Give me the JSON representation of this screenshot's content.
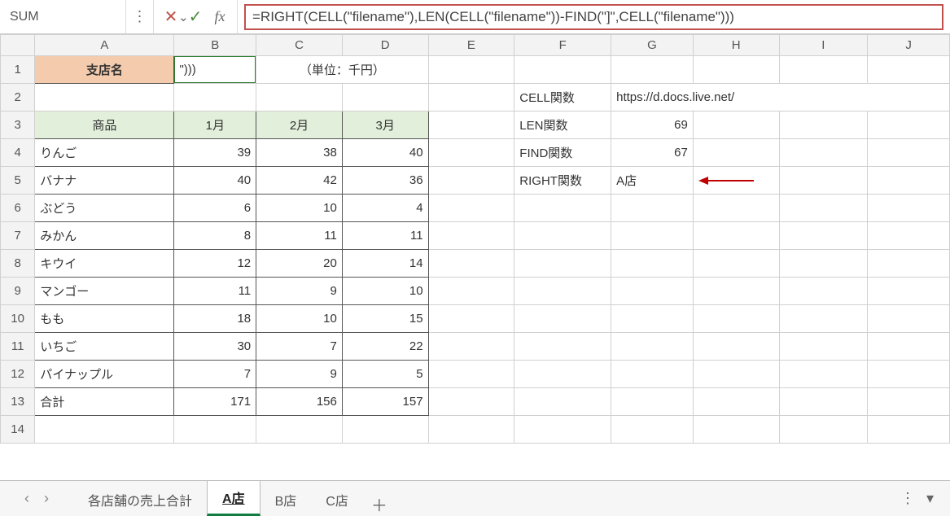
{
  "formula_bar": {
    "name_box": "SUM",
    "formula": "=RIGHT(CELL(\"filename\"),LEN(CELL(\"filename\"))-FIND(\"]\",CELL(\"filename\")))"
  },
  "columns": [
    "A",
    "B",
    "C",
    "D",
    "E",
    "F",
    "G",
    "H",
    "I",
    "J"
  ],
  "row_headers": [
    "1",
    "2",
    "3",
    "4",
    "5",
    "6",
    "7",
    "8",
    "9",
    "10",
    "11",
    "12",
    "13",
    "14"
  ],
  "cells": {
    "A1": "支店名",
    "B1": "\")))",
    "CD1": "（単位：千円）",
    "A3": "商品",
    "B3": "1月",
    "C3": "2月",
    "D3": "3月",
    "F2": "CELL関数",
    "G2": "https://d.docs.live.net/",
    "F3": "LEN関数",
    "G3": "69",
    "F4": "FIND関数",
    "G4": "67",
    "F5": "RIGHT関数",
    "G5": "A店"
  },
  "data_rows": [
    {
      "name": "りんご",
      "m1": "39",
      "m2": "38",
      "m3": "40"
    },
    {
      "name": "バナナ",
      "m1": "40",
      "m2": "42",
      "m3": "36"
    },
    {
      "name": "ぶどう",
      "m1": "6",
      "m2": "10",
      "m3": "4"
    },
    {
      "name": "みかん",
      "m1": "8",
      "m2": "11",
      "m3": "11"
    },
    {
      "name": "キウイ",
      "m1": "12",
      "m2": "20",
      "m3": "14"
    },
    {
      "name": "マンゴー",
      "m1": "11",
      "m2": "9",
      "m3": "10"
    },
    {
      "name": "もも",
      "m1": "18",
      "m2": "10",
      "m3": "15"
    },
    {
      "name": "いちご",
      "m1": "30",
      "m2": "7",
      "m3": "22"
    },
    {
      "name": "パイナップル",
      "m1": "7",
      "m2": "9",
      "m3": "5"
    },
    {
      "name": "合計",
      "m1": "171",
      "m2": "156",
      "m3": "157"
    }
  ],
  "sheet_tabs": {
    "tabs": [
      "各店舗の売上合計",
      "A店",
      "B店",
      "C店"
    ],
    "active_index": 1
  },
  "icons": {
    "chevron": "⌄",
    "dots": "⋮",
    "cancel": "✕",
    "enter": "✓",
    "fx": "fx",
    "prev": "‹",
    "next": "›",
    "plus": "＋",
    "hdots": "⋯",
    "menu": "▾"
  }
}
